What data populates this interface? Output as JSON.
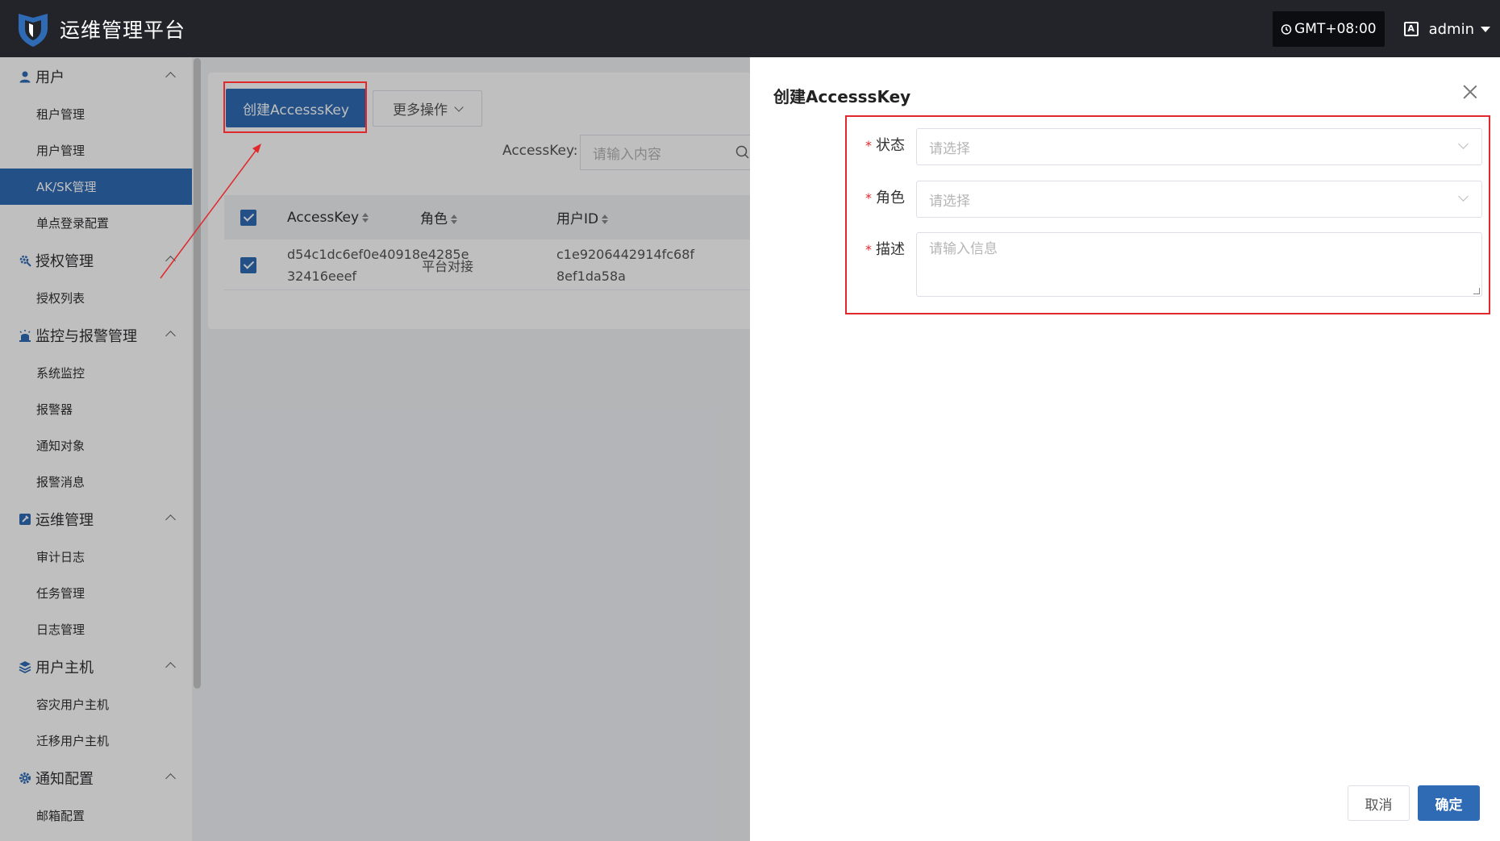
{
  "header": {
    "app_title": "运维管理平台",
    "timezone": "GMT+08:00",
    "user": "admin"
  },
  "sidebar": {
    "groups": [
      {
        "label": "用户",
        "icon": "user-icon",
        "items": [
          "租户管理",
          "用户管理",
          "AK/SK管理",
          "单点登录配置"
        ],
        "active_item": "AK/SK管理"
      },
      {
        "label": "授权管理",
        "icon": "gear-key-icon",
        "items": [
          "授权列表"
        ]
      },
      {
        "label": "监控与报警管理",
        "icon": "alarm-icon",
        "items": [
          "系统监控",
          "报警器",
          "通知对象",
          "报警消息"
        ]
      },
      {
        "label": "运维管理",
        "icon": "wrench-icon",
        "items": [
          "审计日志",
          "任务管理",
          "日志管理"
        ]
      },
      {
        "label": "用户主机",
        "icon": "layers-icon",
        "items": [
          "容灾用户主机",
          "迁移用户主机"
        ]
      },
      {
        "label": "通知配置",
        "icon": "gear-icon",
        "items": [
          "邮箱配置"
        ]
      }
    ]
  },
  "toolbar": {
    "create_label": "创建AccesssKey",
    "more_label": "更多操作",
    "search_label": "AccessKey:",
    "search_placeholder": "请输入内容"
  },
  "table": {
    "columns": [
      "AccessKey",
      "角色",
      "用户ID"
    ],
    "rows": [
      {
        "access_key_line1": "d54c1dc6ef0e40918e4285e",
        "access_key_line2": "32416eeef",
        "role": "平台对接",
        "user_id_line1": "c1e9206442914fc68f",
        "user_id_line2": "8ef1da58a"
      }
    ]
  },
  "drawer": {
    "title": "创建AccesssKey",
    "fields": [
      {
        "label": "状态",
        "placeholder": "请选择",
        "required": true
      },
      {
        "label": "角色",
        "placeholder": "请选择",
        "required": true
      },
      {
        "label": "描述",
        "placeholder": "请输入信息",
        "required": true
      }
    ],
    "cancel_label": "取消",
    "ok_label": "确定"
  },
  "colors": {
    "primary": "#2f6bb5",
    "header_bg": "#222429",
    "highlight": "#e0292c"
  }
}
